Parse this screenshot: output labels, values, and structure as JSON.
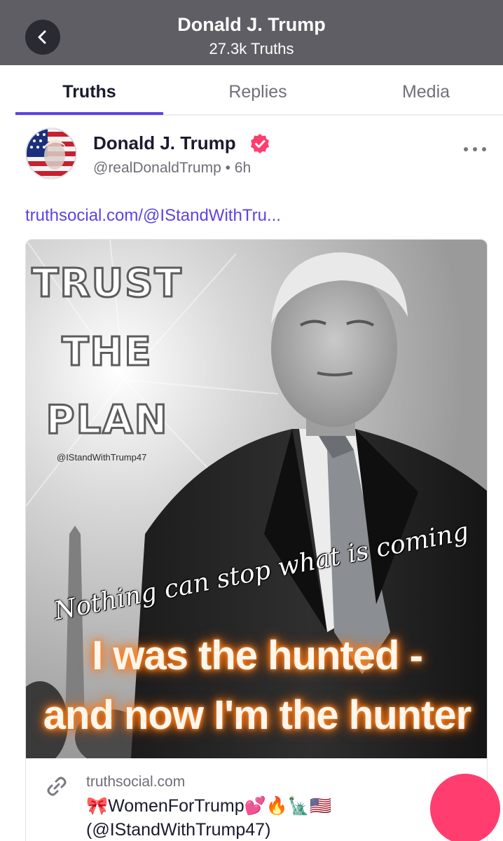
{
  "header": {
    "title": "Donald J. Trump",
    "subtitle": "27.3k Truths"
  },
  "tabs": [
    {
      "label": "Truths",
      "active": true
    },
    {
      "label": "Replies",
      "active": false
    },
    {
      "label": "Media",
      "active": false
    }
  ],
  "post": {
    "author_name": "Donald J. Trump",
    "handle_time": "@realDonaldTrump • 6h",
    "link_text": "truthsocial.com/@IStandWithTru...",
    "image_text": {
      "line1": "TRUST",
      "line2": "THE",
      "line3": "PLAN",
      "handle": "@IStandWithTrump47",
      "script": "Nothing can stop what is coming",
      "hunted_line1": "I  was the hunted -",
      "hunted_line2": "and now I'm the hunter"
    },
    "card": {
      "domain": "truthsocial.com",
      "title_line1": "🎀WomenForTrump💕🔥🗽🇺🇸",
      "title_line2": "(@IStandWithTrump47)"
    }
  },
  "colors": {
    "header_bg": "#5f5e64",
    "accent": "#5b43e6",
    "verified": "#ff3d6e",
    "fab": "#ff3d6e"
  },
  "icons": {
    "back": "chevron-left-icon",
    "verified": "verified-badge-icon",
    "more": "ellipsis-icon",
    "link": "link-icon"
  }
}
